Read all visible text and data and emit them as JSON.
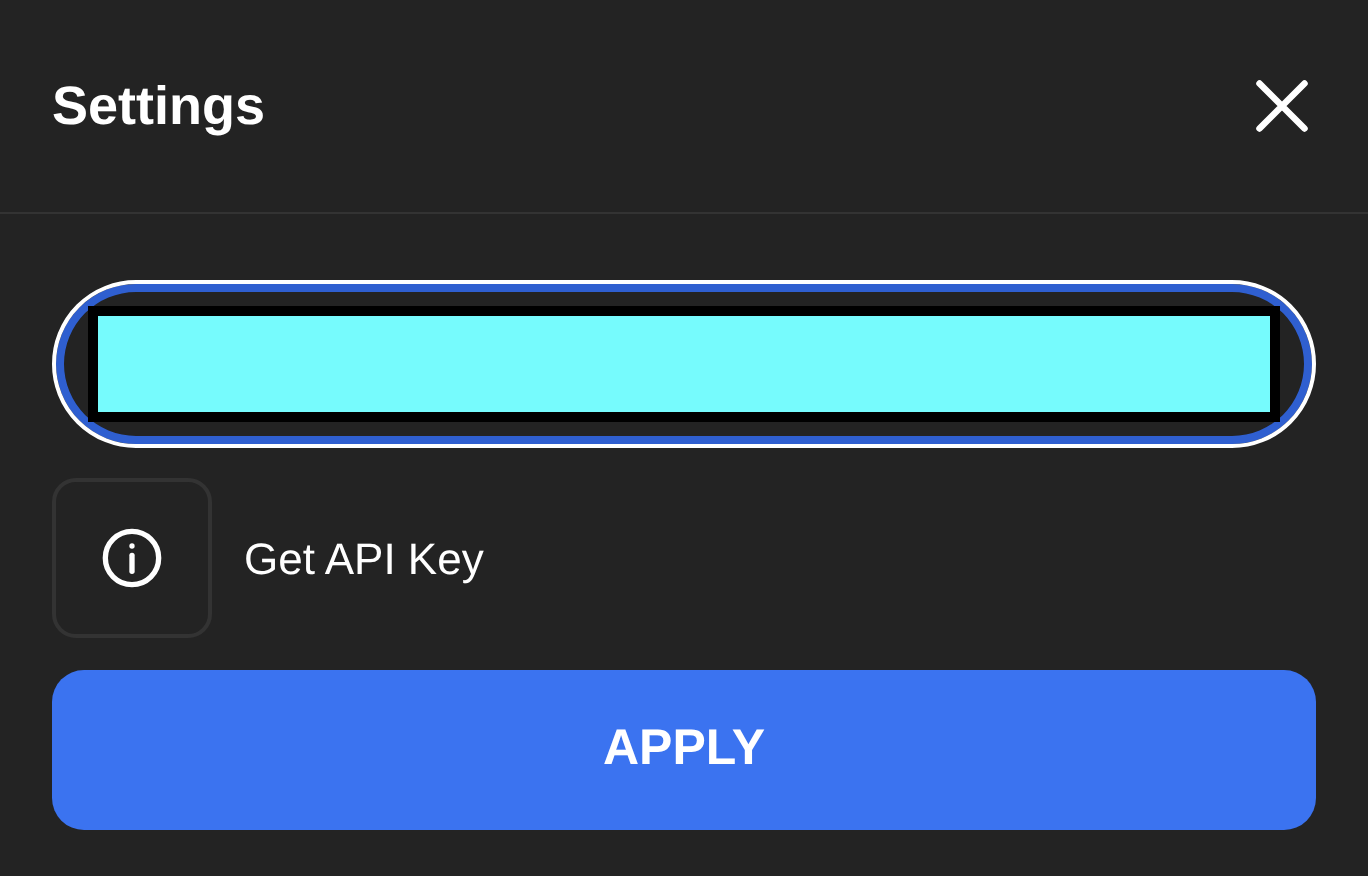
{
  "dialog": {
    "title": "Settings"
  },
  "api_key_field": {
    "focused": true
  },
  "link": {
    "label": "Get API Key"
  },
  "buttons": [
    {
      "label": "APPLY"
    }
  ]
}
